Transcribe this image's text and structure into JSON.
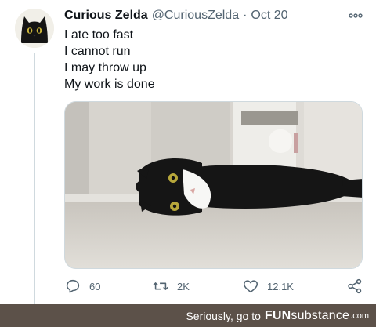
{
  "tweet": {
    "display_name": "Curious Zelda",
    "handle": "@CuriousZelda",
    "separator": "·",
    "date": "Oct 20",
    "lines": [
      "I ate too fast",
      "I cannot run",
      "I may throw up",
      "My work is done"
    ],
    "media_description_icon": "cat-photo",
    "actions": {
      "reply_count": "60",
      "retweet_count": "2K",
      "like_count": "12.1K"
    }
  },
  "footer": {
    "prefix": "Seriously, go to",
    "brand_bold": "FUN",
    "brand_rest": "substance",
    "tld": ".com"
  },
  "colors": {
    "text_primary": "#0f1419",
    "text_secondary": "#536471",
    "footer_bg": "#5c5149",
    "thread_line": "#cfd9de"
  }
}
